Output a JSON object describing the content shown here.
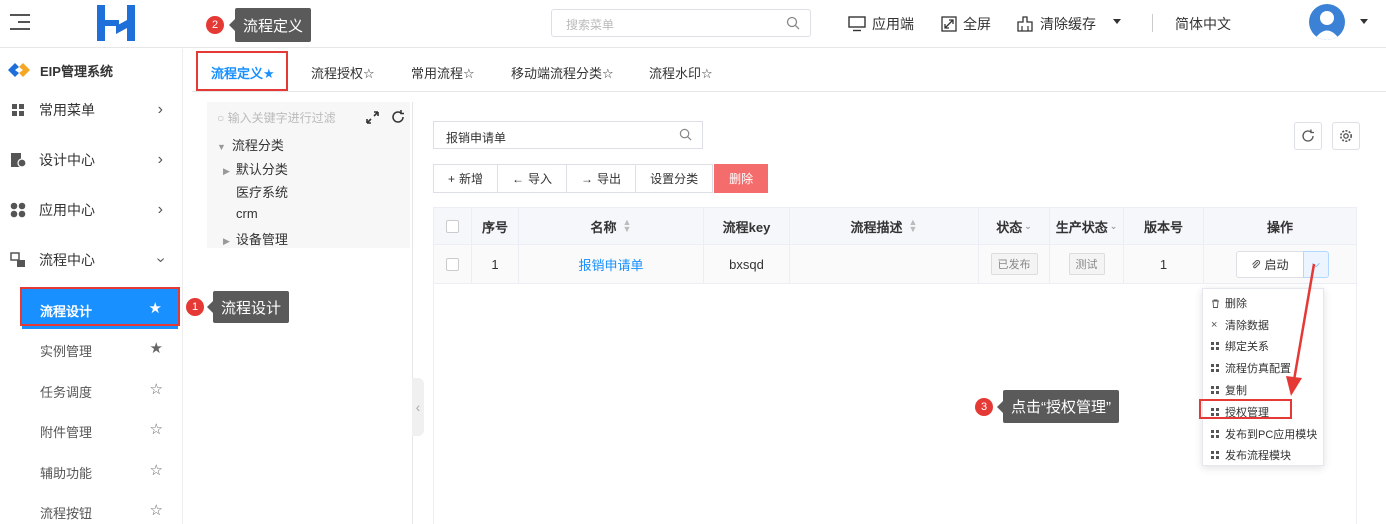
{
  "header": {
    "search_placeholder": "搜索菜单",
    "actions": [
      {
        "label": "应用端",
        "icon": "monitor-icon"
      },
      {
        "label": "全屏",
        "icon": "fullscreen-icon"
      },
      {
        "label": "清除缓存",
        "icon": "broom-icon"
      },
      {
        "label": "简体中文",
        "icon": "language"
      }
    ]
  },
  "sidebar": {
    "system_title": "EIP管理系统",
    "menus": [
      {
        "label": "常用菜单",
        "icon": "grid-icon"
      },
      {
        "label": "设计中心",
        "icon": "design-icon"
      },
      {
        "label": "应用中心",
        "icon": "apps-icon"
      },
      {
        "label": "流程中心",
        "icon": "flow-icon"
      }
    ],
    "subitems": [
      {
        "label": "流程设计"
      },
      {
        "label": "实例管理"
      },
      {
        "label": "任务调度"
      },
      {
        "label": "附件管理"
      },
      {
        "label": "辅助功能"
      },
      {
        "label": "流程按钮"
      }
    ]
  },
  "tabs": [
    {
      "label": "流程定义"
    },
    {
      "label": "流程授权"
    },
    {
      "label": "常用流程"
    },
    {
      "label": "移动端流程分类"
    },
    {
      "label": "流程水印"
    }
  ],
  "tree": {
    "filter_placeholder": "输入关键字进行过滤",
    "root": "流程分类",
    "nodes": [
      "默认分类",
      "医疗系统",
      "crm",
      "设备管理"
    ]
  },
  "list": {
    "search_value": "报销申请单",
    "toolbar": {
      "add": "新增",
      "import": "导入",
      "export": "导出",
      "set_category": "设置分类",
      "delete": "删除"
    },
    "columns": {
      "index": "序号",
      "name": "名称",
      "key": "流程key",
      "desc": "流程描述",
      "status": "状态",
      "prod_status": "生产状态",
      "version": "版本号",
      "ops": "操作"
    },
    "rows": [
      {
        "index": "1",
        "name": "报销申请单",
        "key": "bxsqd",
        "desc": "",
        "status": "已发布",
        "prod_status": "测试",
        "version": "1",
        "start": "启动"
      }
    ]
  },
  "dropdown": {
    "items": [
      "删除",
      "清除数据",
      "绑定关系",
      "流程仿真配置",
      "复制",
      "授权管理",
      "发布到PC应用模块",
      "发布流程模块"
    ]
  },
  "callouts": [
    {
      "num": "1",
      "text": "流程设计"
    },
    {
      "num": "2",
      "text": "流程定义"
    },
    {
      "num": "3",
      "text": "点击“授权管理”"
    }
  ],
  "colors": {
    "accent": "#1890ff",
    "danger": "#f56c6c",
    "highlight": "#e53935",
    "tooltip": "#5a5a5a"
  }
}
